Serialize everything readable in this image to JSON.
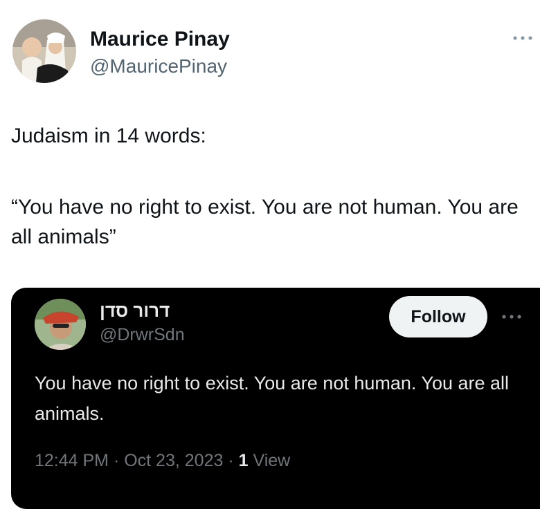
{
  "tweet": {
    "author": {
      "name": "Maurice Pinay",
      "handle": "@MauricePinay"
    },
    "line1": "Judaism in 14 words:",
    "quote": "“You have no right to exist. You are not human. You are all animals”",
    "more_icon": "more-horizontal-icon"
  },
  "quoted_tweet": {
    "author": {
      "name": "דרור סדן",
      "handle": "@DrwrSdn"
    },
    "follow_label": "Follow",
    "text": "You have no right to exist. You are not human. You are all animals.",
    "timestamp": "12:44 PM · Oct 23, 2023",
    "separator": " · ",
    "views_count": "1",
    "views_label": "View",
    "more_icon": "more-horizontal-icon"
  },
  "colors": {
    "text_primary": "#0f1419",
    "text_secondary": "#536471",
    "card_background": "#000000",
    "card_text": "#e7e9ea",
    "card_secondary": "#71767b",
    "follow_button": "#eff3f4"
  }
}
